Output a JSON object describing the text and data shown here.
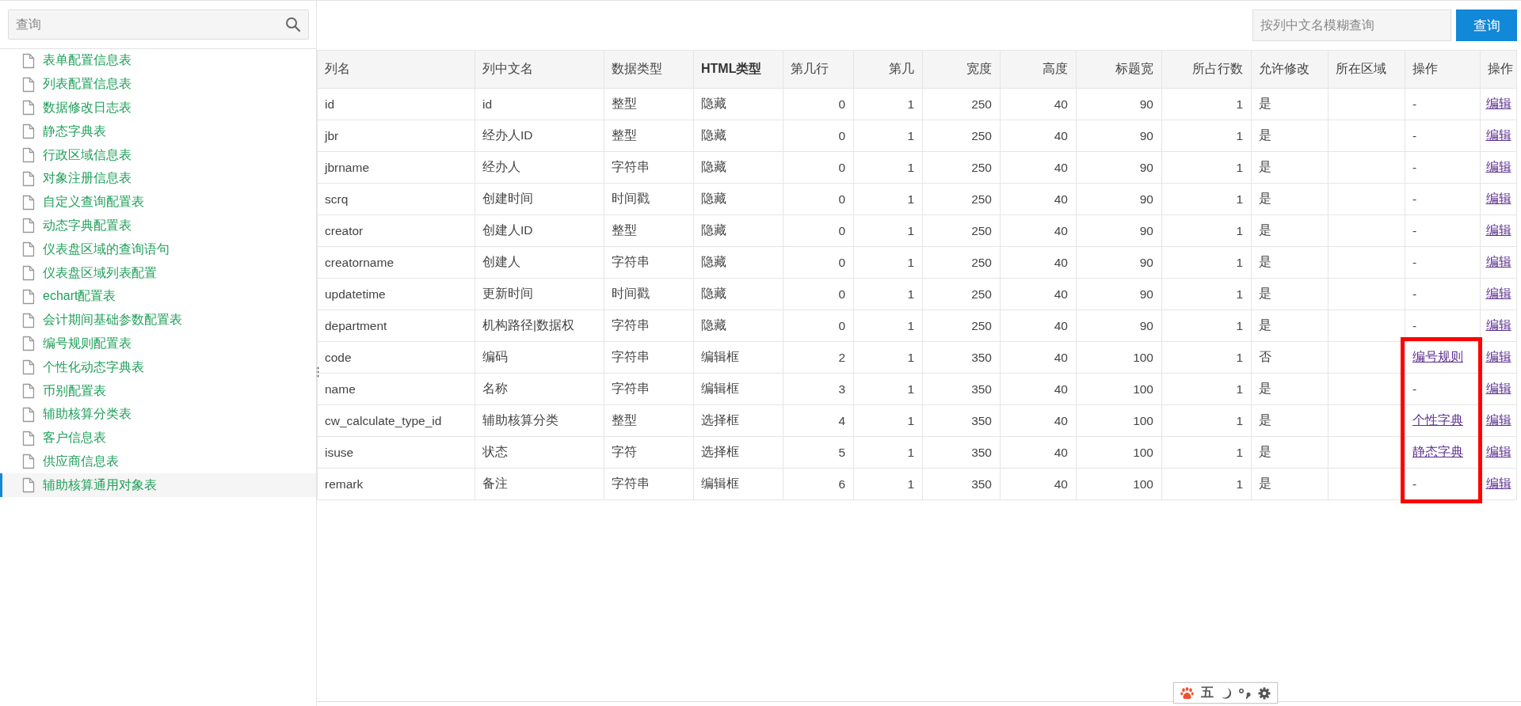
{
  "sidebar": {
    "search": {
      "placeholder": "查询"
    },
    "items": [
      {
        "label": "表单配置信息表",
        "selected": false
      },
      {
        "label": "列表配置信息表",
        "selected": false
      },
      {
        "label": "数据修改日志表",
        "selected": false
      },
      {
        "label": "静态字典表",
        "selected": false
      },
      {
        "label": "行政区域信息表",
        "selected": false
      },
      {
        "label": "对象注册信息表",
        "selected": false
      },
      {
        "label": "自定义查询配置表",
        "selected": false
      },
      {
        "label": "动态字典配置表",
        "selected": false
      },
      {
        "label": "仪表盘区域的查询语句",
        "selected": false
      },
      {
        "label": "仪表盘区域列表配置",
        "selected": false
      },
      {
        "label": "echart配置表",
        "selected": false
      },
      {
        "label": "会计期间基础参数配置表",
        "selected": false
      },
      {
        "label": "编号规则配置表",
        "selected": false
      },
      {
        "label": "个性化动态字典表",
        "selected": false
      },
      {
        "label": "币别配置表",
        "selected": false
      },
      {
        "label": "辅助核算分类表",
        "selected": false
      },
      {
        "label": "客户信息表",
        "selected": false
      },
      {
        "label": "供应商信息表",
        "selected": false
      },
      {
        "label": "辅助核算通用对象表",
        "selected": true
      }
    ]
  },
  "toolbar": {
    "search": {
      "placeholder": "按列中文名模糊查询"
    },
    "button": "查询"
  },
  "table": {
    "columns": [
      "列名",
      "列中文名",
      "数据类型",
      "HTML类型",
      "第几行",
      "第几",
      "宽度",
      "高度",
      "标题宽",
      "所占行数",
      "允许修改",
      "所在区域",
      "操作",
      "操作"
    ],
    "rows": [
      {
        "cells": [
          "id",
          "id",
          "整型",
          "隐藏",
          "0",
          "1",
          "250",
          "40",
          "90",
          "1",
          "是"
        ],
        "action": {
          "kind": "text",
          "label": "-",
          "highlighted": false
        },
        "edit": "编辑"
      },
      {
        "cells": [
          "jbr",
          "经办人ID",
          "整型",
          "隐藏",
          "0",
          "1",
          "250",
          "40",
          "90",
          "1",
          "是"
        ],
        "action": {
          "kind": "text",
          "label": "-",
          "highlighted": false
        },
        "edit": "编辑"
      },
      {
        "cells": [
          "jbrname",
          "经办人",
          "字符串",
          "隐藏",
          "0",
          "1",
          "250",
          "40",
          "90",
          "1",
          "是"
        ],
        "action": {
          "kind": "text",
          "label": "-",
          "highlighted": false
        },
        "edit": "编辑"
      },
      {
        "cells": [
          "scrq",
          "创建时间",
          "时间戳",
          "隐藏",
          "0",
          "1",
          "250",
          "40",
          "90",
          "1",
          "是"
        ],
        "action": {
          "kind": "text",
          "label": "-",
          "highlighted": false
        },
        "edit": "编辑"
      },
      {
        "cells": [
          "creator",
          "创建人ID",
          "整型",
          "隐藏",
          "0",
          "1",
          "250",
          "40",
          "90",
          "1",
          "是"
        ],
        "action": {
          "kind": "text",
          "label": "-",
          "highlighted": false
        },
        "edit": "编辑"
      },
      {
        "cells": [
          "creatorname",
          "创建人",
          "字符串",
          "隐藏",
          "0",
          "1",
          "250",
          "40",
          "90",
          "1",
          "是"
        ],
        "action": {
          "kind": "text",
          "label": "-",
          "highlighted": false
        },
        "edit": "编辑"
      },
      {
        "cells": [
          "updatetime",
          "更新时间",
          "时间戳",
          "隐藏",
          "0",
          "1",
          "250",
          "40",
          "90",
          "1",
          "是"
        ],
        "action": {
          "kind": "text",
          "label": "-",
          "highlighted": false
        },
        "edit": "编辑"
      },
      {
        "cells": [
          "department",
          "机构路径|数据权",
          "字符串",
          "隐藏",
          "0",
          "1",
          "250",
          "40",
          "90",
          "1",
          "是"
        ],
        "action": {
          "kind": "text",
          "label": "-",
          "highlighted": false
        },
        "edit": "编辑"
      },
      {
        "cells": [
          "code",
          "编码",
          "字符串",
          "编辑框",
          "2",
          "1",
          "350",
          "40",
          "100",
          "1",
          "否"
        ],
        "action": {
          "kind": "link",
          "label": "编号规则",
          "highlighted": true
        },
        "edit": "编辑"
      },
      {
        "cells": [
          "name",
          "名称",
          "字符串",
          "编辑框",
          "3",
          "1",
          "350",
          "40",
          "100",
          "1",
          "是"
        ],
        "action": {
          "kind": "text",
          "label": "-",
          "highlighted": true
        },
        "edit": "编辑"
      },
      {
        "cells": [
          "cw_calculate_type_id",
          "辅助核算分类",
          "整型",
          "选择框",
          "4",
          "1",
          "350",
          "40",
          "100",
          "1",
          "是"
        ],
        "action": {
          "kind": "link",
          "label": "个性字典",
          "highlighted": true
        },
        "edit": "编辑"
      },
      {
        "cells": [
          "isuse",
          "状态",
          "字符",
          "选择框",
          "5",
          "1",
          "350",
          "40",
          "100",
          "1",
          "是"
        ],
        "action": {
          "kind": "link",
          "label": "静态字典",
          "highlighted": true
        },
        "edit": "编辑"
      },
      {
        "cells": [
          "remark",
          "备注",
          "字符串",
          "编辑框",
          "6",
          "1",
          "350",
          "40",
          "100",
          "1",
          "是"
        ],
        "action": {
          "kind": "text",
          "label": "-",
          "highlighted": true
        },
        "edit": "编辑"
      }
    ]
  },
  "ime_toolbar": {
    "mode": "五"
  }
}
